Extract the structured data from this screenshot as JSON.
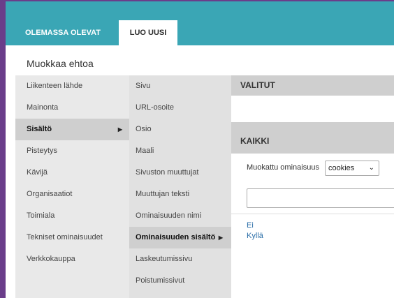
{
  "tabs": [
    {
      "label": "OLEMASSA OLEVAT",
      "active": false
    },
    {
      "label": "LUO UUSI",
      "active": true
    }
  ],
  "page_title": "Muokkaa ehtoa",
  "categories": [
    {
      "label": "Liikenteen lähde"
    },
    {
      "label": "Mainonta"
    },
    {
      "label": "Sisältö",
      "selected": true
    },
    {
      "label": "Pisteytys"
    },
    {
      "label": "Kävijä"
    },
    {
      "label": "Organisaatiot"
    },
    {
      "label": "Toimiala"
    },
    {
      "label": "Tekniset ominaisuudet"
    },
    {
      "label": "Verkkokauppa"
    }
  ],
  "subcategories": [
    {
      "label": "Sivu"
    },
    {
      "label": "URL-osoite"
    },
    {
      "label": "Osio"
    },
    {
      "label": "Maali"
    },
    {
      "label": "Sivuston muuttujat"
    },
    {
      "label": "Muuttujan teksti"
    },
    {
      "label": "Ominaisuuden nimi"
    },
    {
      "label": "Ominaisuuden sisältö",
      "selected": true
    },
    {
      "label": "Laskeutumissivu"
    },
    {
      "label": "Poistumissivut"
    }
  ],
  "selected_section": {
    "header": "VALITUT"
  },
  "all_section": {
    "header": "KAIKKI",
    "property_label": "Muokattu ominaisuus",
    "property_value": "cookies",
    "values": [
      "Ei",
      "Kyllä"
    ]
  },
  "icons": {
    "submenu_arrow": "caret-right-icon",
    "select_chevron": "chevron-down-icon"
  },
  "colors": {
    "tabbar": "#3aa6b5",
    "frame": "#6a3d8a",
    "link": "#2a6ea8"
  }
}
